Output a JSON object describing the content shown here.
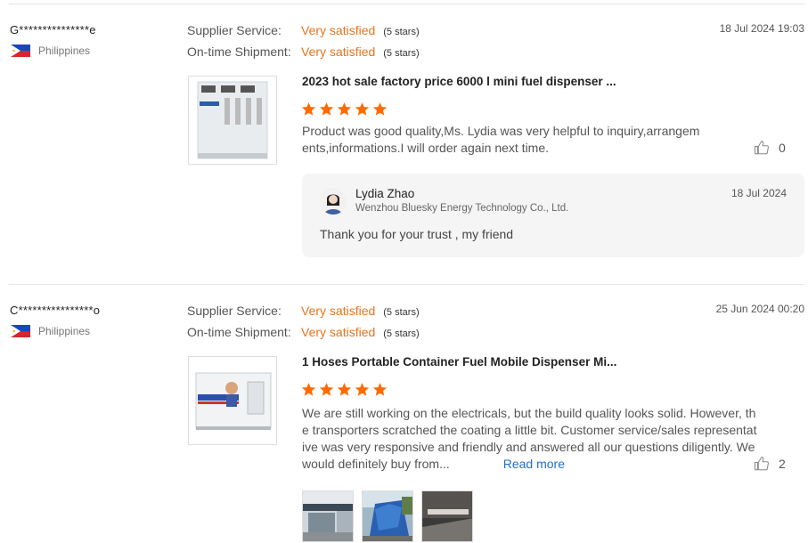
{
  "reviews": [
    {
      "buyer": "G***************e",
      "country": "Philippines",
      "supplier_label": "Supplier Service:",
      "supplier_value": "Very satisfied",
      "supplier_stars": "(5 stars)",
      "shipment_label": "On-time Shipment:",
      "shipment_value": "Very satisfied",
      "shipment_stars": "(5 stars)",
      "date": "18 Jul 2024 19:03",
      "product_title": "2023 hot sale factory price 6000 l mini fuel dispenser ...",
      "rating": 5,
      "text": "Product was good quality,Ms. Lydia was very helpful to inquiry,arrangements,informations.I will order again next time.",
      "likes": "0",
      "reply": {
        "name": "Lydia Zhao",
        "company": "Wenzhou Bluesky Energy Technology Co., Ltd.",
        "date": "18 Jul 2024",
        "message": "Thank you for your trust ,  my friend"
      }
    },
    {
      "buyer": "C****************o",
      "country": "Philippines",
      "supplier_label": "Supplier Service:",
      "supplier_value": "Very satisfied",
      "supplier_stars": "(5 stars)",
      "shipment_label": "On-time Shipment:",
      "shipment_value": "Very satisfied",
      "shipment_stars": "(5 stars)",
      "date": "25 Jun 2024 00:20",
      "product_title": "1 Hoses Portable Container Fuel Mobile Dispenser Mi...",
      "rating": 5,
      "text": "We are still working on the electricals, but the build quality looks solid. However, the transporters scratched the coating a little bit. Customer service/sales representative was very responsive and friendly and answered all our questions diligently. We would definitely buy from...",
      "read_more": "Read more",
      "likes": "2"
    }
  ],
  "colors": {
    "accent": "#e8741c",
    "link": "#1f6fd1",
    "star": "#ff6a00"
  }
}
